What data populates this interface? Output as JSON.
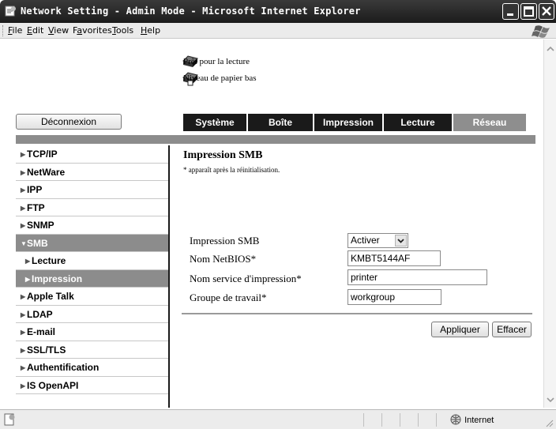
{
  "window": {
    "title": "Network Setting - Admin Mode - Microsoft Internet Explorer"
  },
  "menu": [
    {
      "pre": "",
      "key": "F",
      "post": "ile"
    },
    {
      "pre": "",
      "key": "E",
      "post": "dit"
    },
    {
      "pre": "",
      "key": "V",
      "post": "iew"
    },
    {
      "pre": "F",
      "key": "a",
      "post": "vorites"
    },
    {
      "pre": "",
      "key": "T",
      "post": "ools"
    },
    {
      "pre": "",
      "key": "H",
      "post": "elp"
    }
  ],
  "status_messages": {
    "ready": "Prêt pour la lecture",
    "paper_low": "Niveau de papier bas"
  },
  "logout_label": "Déconnexion",
  "tabs": [
    "Système",
    "Boîte",
    "Impression",
    "Lecture",
    "Réseau"
  ],
  "active_tab": "Réseau",
  "sidebar": [
    {
      "label": "TCP/IP"
    },
    {
      "label": "NetWare"
    },
    {
      "label": "IPP"
    },
    {
      "label": "FTP"
    },
    {
      "label": "SNMP"
    },
    {
      "label": "SMB"
    },
    {
      "label": "Lecture"
    },
    {
      "label": "Impression"
    },
    {
      "label": "Apple Talk"
    },
    {
      "label": "LDAP"
    },
    {
      "label": "E-mail"
    },
    {
      "label": "SSL/TLS"
    },
    {
      "label": "Authentification"
    },
    {
      "label": "IS OpenAPI"
    }
  ],
  "main": {
    "title": "Impression SMB",
    "note": "* apparaît après la réinitialisation.",
    "form": {
      "smb_label": "Impression SMB",
      "smb_value": "Activer",
      "netbios_label": "Nom NetBIOS*",
      "netbios_value": "KMBT5144AF",
      "service_label": "Nom service d'impression*",
      "service_value": "printer",
      "workgroup_label": "Groupe de travail*",
      "workgroup_value": "workgroup"
    },
    "apply_label": "Appliquer",
    "clear_label": "Effacer"
  },
  "statusbar": {
    "zone": "Internet"
  },
  "colors": {
    "tab_bg": "#1a1a1a",
    "tab_active": "#8e8e8e",
    "sidebar_selected": "#8c8c8c",
    "title_bar": "#2a2a2a"
  }
}
